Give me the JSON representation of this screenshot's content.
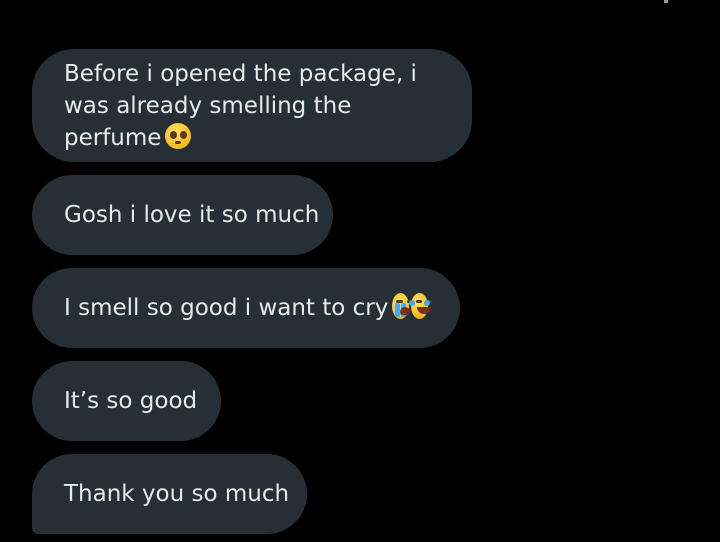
{
  "messages": [
    {
      "text": "Before i opened the package, i was already smelling the perfume",
      "emoji": [
        "pleading-face-emoji"
      ]
    },
    {
      "text": "Gosh i love it so much",
      "emoji": []
    },
    {
      "text": "I smell so good i want to cry",
      "emoji": [
        "loudly-crying-face-emoji",
        "face-with-tears-of-joy-emoji"
      ]
    },
    {
      "text": "It’s so good",
      "emoji": []
    },
    {
      "text": "Thank you so much",
      "emoji": []
    }
  ],
  "colors": {
    "background": "#000000",
    "bubble": "#262f36",
    "text": "#e7e9ea"
  }
}
